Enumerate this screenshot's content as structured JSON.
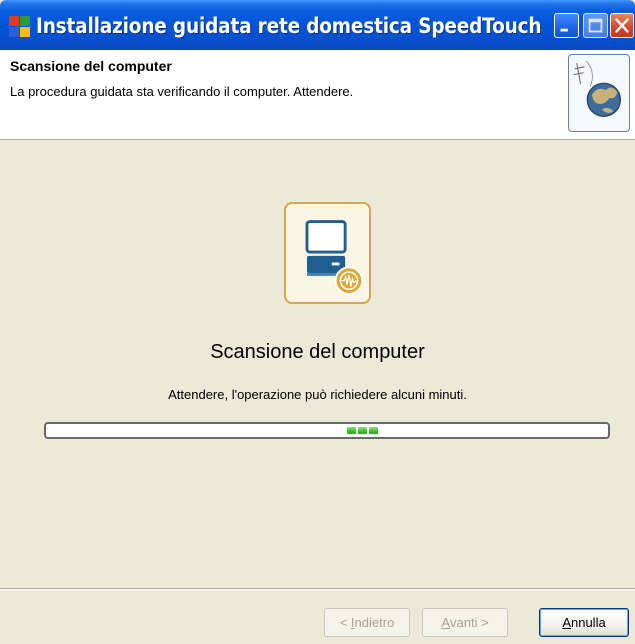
{
  "window": {
    "title": "Installazione guidata rete domestica SpeedTouch",
    "icon": "speedtouch-app-icon"
  },
  "header": {
    "title": "Scansione del computer",
    "subtitle": "La procedura guidata sta verificando il computer. Attendere.",
    "logo_icon": "network-globe-icon"
  },
  "main": {
    "icon": "computer-scan-icon",
    "title": "Scansione del computer",
    "subtitle": "Attendere, l'operazione può richiedere alcuni minuti.",
    "progress_state": "indeterminate"
  },
  "buttons": {
    "back_prefix": "< ",
    "back_key": "I",
    "back_rest": "ndietro",
    "next_key": "A",
    "next_rest": "vanti",
    "next_suffix": " >",
    "cancel_key": "A",
    "cancel_rest": "nnulla"
  },
  "colors": {
    "titlebar": "#0454d6",
    "face": "#ece9d8",
    "progress_fill": "#3cbf2b",
    "icon_border": "#d6a84b"
  }
}
